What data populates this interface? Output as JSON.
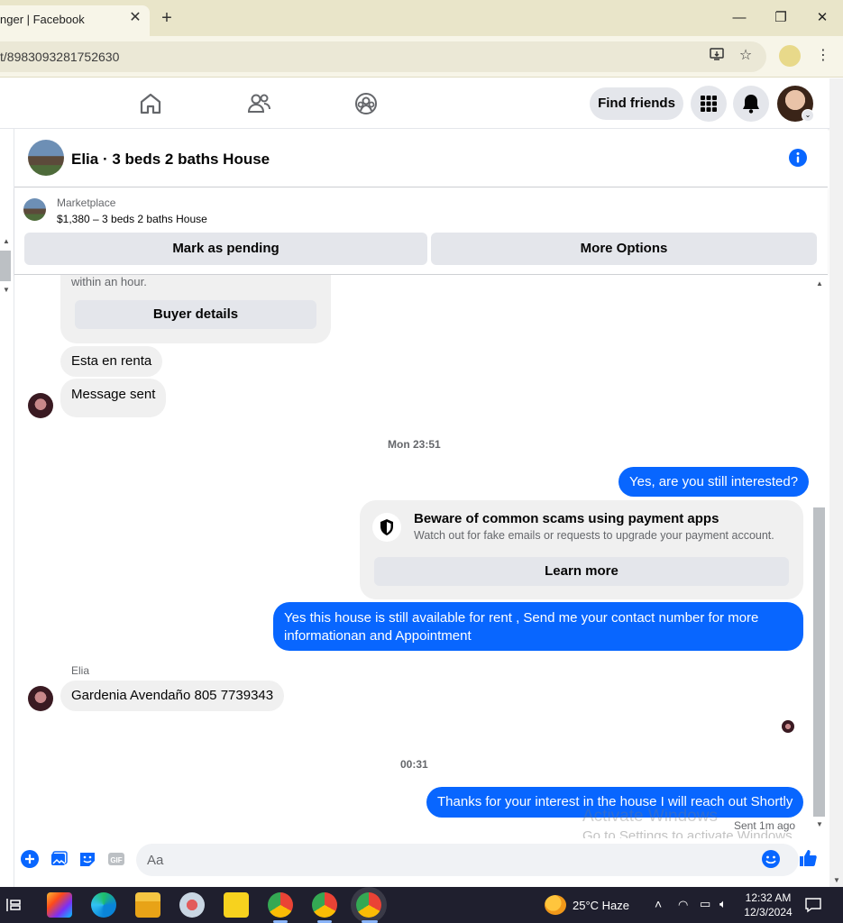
{
  "browser": {
    "tab_title": "nger | Facebook",
    "tab_close": "✕",
    "new_tab": "+",
    "url": "t/8983093281752630",
    "window_controls": {
      "minimize": "—",
      "restore": "❐",
      "close": "✕"
    }
  },
  "header": {
    "find_friends": "Find friends"
  },
  "conversation": {
    "title": "Elia · 3 beds 2 baths House"
  },
  "marketplace": {
    "label": "Marketplace",
    "listing": "$1,380 – 3 beds 2 baths House",
    "mark_pending": "Mark as pending",
    "more_options": "More Options"
  },
  "messages": {
    "card_text": "within an hour.",
    "buyer_details": "Buyer details",
    "in_1": "Esta en renta",
    "in_2": "Message sent",
    "time_1": "Mon 23:51",
    "out_1": "Yes, are you still interested?",
    "scam_title": "Beware of common scams using payment apps",
    "scam_sub": "Watch out for fake emails or requests to upgrade your payment account.",
    "learn_more": "Learn more",
    "out_2": "Yes this house is still available for rent , Send me your contact number for more informationan and Appointment",
    "sender": "Elia",
    "in_3": "Gardenia Avendaño  805 7739343",
    "time_2": "00:31",
    "out_3": "Thanks for your interest in the house I will reach out Shortly",
    "sent_status": "Sent 1m ago"
  },
  "composer": {
    "placeholder": "Aa"
  },
  "watermark": {
    "line1": "Activate Windows",
    "line2": "Go to Settings to activate Windows."
  },
  "taskbar": {
    "weather": "25°C  Haze",
    "time": "12:32 AM",
    "date": "12/3/2024"
  },
  "colors": {
    "messenger_blue": "#0866ff",
    "bubble_gray": "#f0f0f0",
    "button_gray": "#e4e6eb"
  }
}
